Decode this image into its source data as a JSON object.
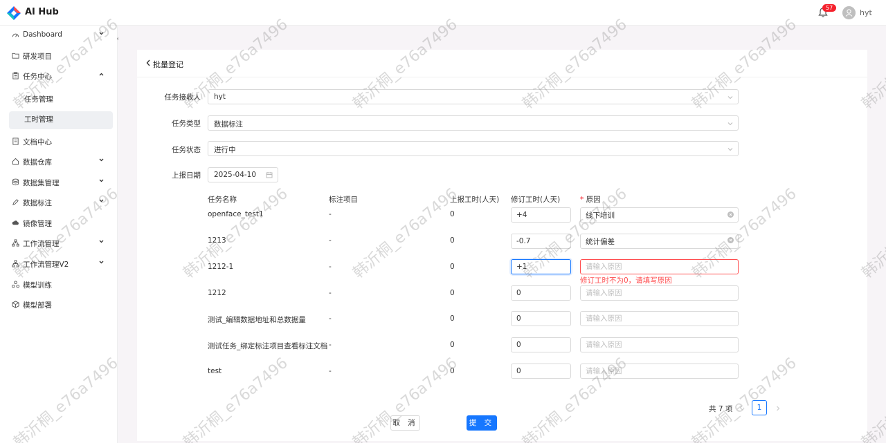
{
  "app": {
    "title": "AI Hub",
    "notification_count": "57",
    "username": "hyt"
  },
  "sidebar": {
    "items": [
      {
        "label": "Dashboard",
        "icon": "dashboard-icon"
      },
      {
        "label": "研发项目",
        "icon": "folder-icon"
      },
      {
        "label": "任务中心",
        "icon": "clipboard-icon",
        "expanded": true
      },
      {
        "label": "任务管理"
      },
      {
        "label": "工时管理",
        "active": true
      },
      {
        "label": "文档中心",
        "icon": "document-icon"
      },
      {
        "label": "数据仓库",
        "icon": "home-icon"
      },
      {
        "label": "数据集管理",
        "icon": "database-icon"
      },
      {
        "label": "数据标注",
        "icon": "pen-icon"
      },
      {
        "label": "镜像管理",
        "icon": "cloud-icon"
      },
      {
        "label": "工作流管理",
        "icon": "workflow-icon"
      },
      {
        "label": "工作流管理V2",
        "icon": "workflow-icon"
      },
      {
        "label": "模型训练",
        "icon": "model-icon"
      },
      {
        "label": "模型部署",
        "icon": "deploy-icon"
      }
    ]
  },
  "page": {
    "title": "批量登记",
    "form": {
      "receiver_label": "任务接收人",
      "receiver_value": "hyt",
      "type_label": "任务类型",
      "type_value": "数据标注",
      "status_label": "任务状态",
      "status_value": "进行中",
      "date_label": "上报日期",
      "date_value": "2025-04-10"
    },
    "table": {
      "headers": {
        "name": "任务名称",
        "project": "标注项目",
        "reported": "上报工时(人天)",
        "revised": "修订工时(人天)",
        "reason_star": "*",
        "reason": "原因"
      },
      "reason_placeholder": "请输入原因",
      "rows": [
        {
          "name": "openface_test1",
          "project": "-",
          "reported": "0",
          "revised": "+4",
          "reason": "线下培训"
        },
        {
          "name": "1213",
          "project": "-",
          "reported": "0",
          "revised": "-0.7",
          "reason": "统计偏差"
        },
        {
          "name": "1212-1",
          "project": "-",
          "reported": "0",
          "revised": "+1",
          "reason": ""
        },
        {
          "name": "1212",
          "project": "-",
          "reported": "0",
          "revised": "0",
          "reason": ""
        },
        {
          "name": "测试_编辑数据地址和总数据量",
          "project": "-",
          "reported": "0",
          "revised": "0",
          "reason": ""
        },
        {
          "name": "测试任务_绑定标注项目查看标注文档",
          "project": "-",
          "reported": "0",
          "revised": "0",
          "reason": ""
        },
        {
          "name": "test",
          "project": "-",
          "reported": "0",
          "revised": "0",
          "reason": ""
        }
      ],
      "error_message": "修订工时不为0，请填写原因"
    },
    "pagination": {
      "total": "共 7 项",
      "current": "1"
    },
    "actions": {
      "cancel": "取 消",
      "submit": "提 交"
    }
  },
  "watermark": "韩沂桐_e76a7496",
  "colors": {
    "primary": "#1677ff",
    "error": "#ff4d4f",
    "badge": "#f5222d"
  }
}
